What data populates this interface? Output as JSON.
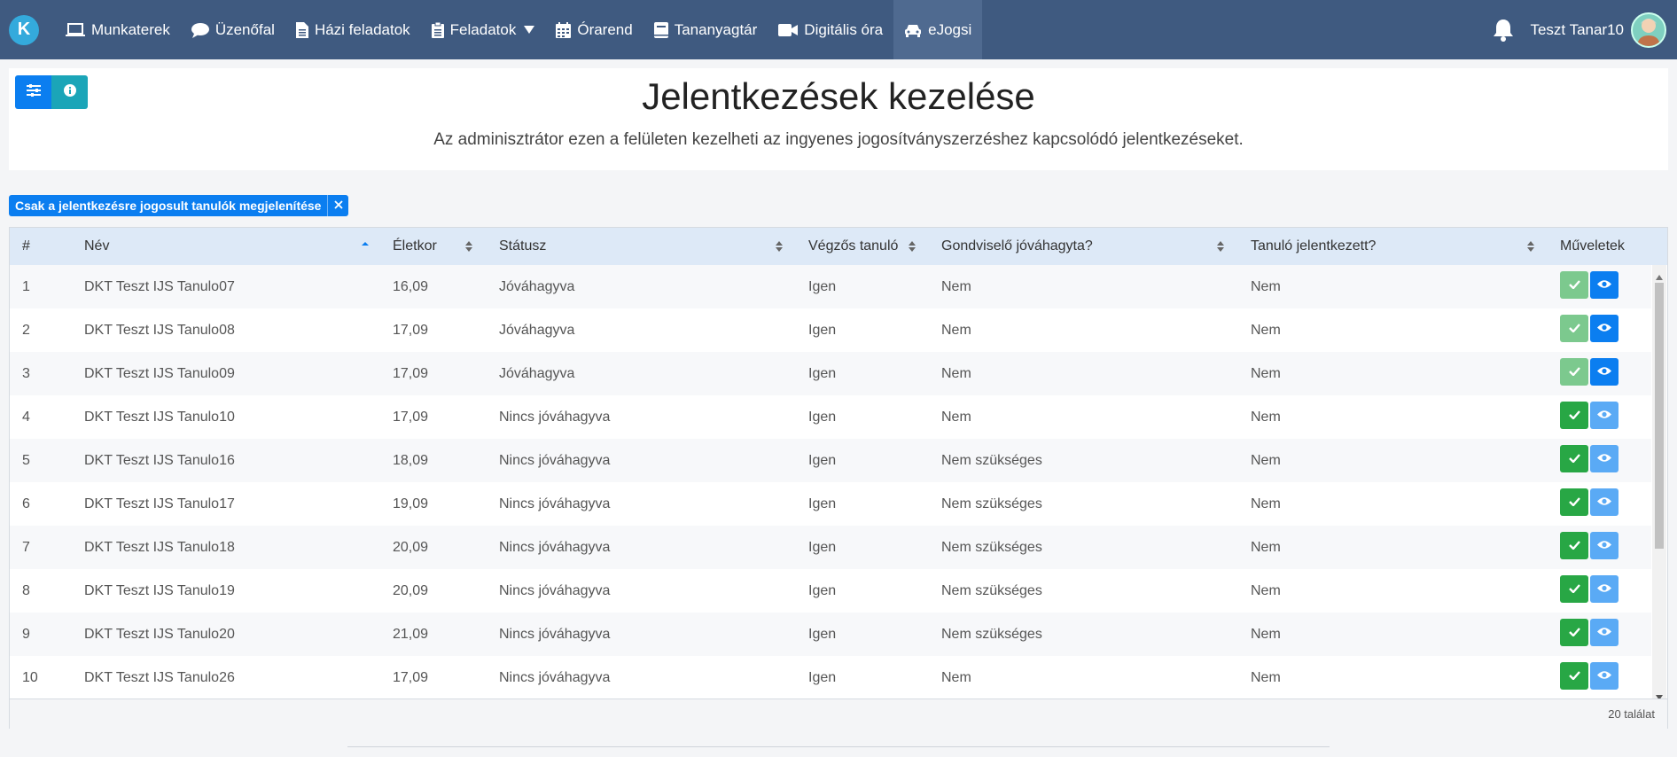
{
  "nav": {
    "logo": "K",
    "items": [
      {
        "label": "Munkaterek",
        "icon": "laptop-icon"
      },
      {
        "label": "Üzenőfal",
        "icon": "chat-icon"
      },
      {
        "label": "Házi feladatok",
        "icon": "document-icon"
      },
      {
        "label": "Feladatok",
        "icon": "clipboard-icon"
      },
      {
        "label": "Órarend",
        "icon": "calendar-icon"
      },
      {
        "label": "Tananyagtár",
        "icon": "book-icon"
      },
      {
        "label": "Digitális óra",
        "icon": "video-icon"
      },
      {
        "label": "eJogsi",
        "icon": "car-icon"
      }
    ],
    "user": "Teszt Tanar10"
  },
  "header": {
    "title": "Jelentkezések kezelése",
    "subtitle": "Az adminisztrátor ezen a felületen kezelheti az ingyenes jogosítványszerzéshez kapcsolódó jelentkezéseket."
  },
  "filter_chip": "Csak a jelentkezésre jogosult tanulók megjelenítése",
  "table": {
    "headers": [
      "#",
      "Név",
      "Életkor",
      "Státusz",
      "Végzős tanuló",
      "Gondviselő jóváhagyta?",
      "Tanuló jelentkezett?",
      "Műveletek"
    ],
    "rows": [
      {
        "n": "1",
        "name": "DKT Teszt IJS Tanulo07",
        "age": "16,09",
        "status": "Jóváhagyva",
        "final": "Igen",
        "guardian": "Nem",
        "applied": "Nem",
        "approved": true
      },
      {
        "n": "2",
        "name": "DKT Teszt IJS Tanulo08",
        "age": "17,09",
        "status": "Jóváhagyva",
        "final": "Igen",
        "guardian": "Nem",
        "applied": "Nem",
        "approved": true
      },
      {
        "n": "3",
        "name": "DKT Teszt IJS Tanulo09",
        "age": "17,09",
        "status": "Jóváhagyva",
        "final": "Igen",
        "guardian": "Nem",
        "applied": "Nem",
        "approved": true
      },
      {
        "n": "4",
        "name": "DKT Teszt IJS Tanulo10",
        "age": "17,09",
        "status": "Nincs jóváhagyva",
        "final": "Igen",
        "guardian": "Nem",
        "applied": "Nem",
        "approved": false
      },
      {
        "n": "5",
        "name": "DKT Teszt IJS Tanulo16",
        "age": "18,09",
        "status": "Nincs jóváhagyva",
        "final": "Igen",
        "guardian": "Nem szükséges",
        "applied": "Nem",
        "approved": false
      },
      {
        "n": "6",
        "name": "DKT Teszt IJS Tanulo17",
        "age": "19,09",
        "status": "Nincs jóváhagyva",
        "final": "Igen",
        "guardian": "Nem szükséges",
        "applied": "Nem",
        "approved": false
      },
      {
        "n": "7",
        "name": "DKT Teszt IJS Tanulo18",
        "age": "20,09",
        "status": "Nincs jóváhagyva",
        "final": "Igen",
        "guardian": "Nem szükséges",
        "applied": "Nem",
        "approved": false
      },
      {
        "n": "8",
        "name": "DKT Teszt IJS Tanulo19",
        "age": "20,09",
        "status": "Nincs jóváhagyva",
        "final": "Igen",
        "guardian": "Nem szükséges",
        "applied": "Nem",
        "approved": false
      },
      {
        "n": "9",
        "name": "DKT Teszt IJS Tanulo20",
        "age": "21,09",
        "status": "Nincs jóváhagyva",
        "final": "Igen",
        "guardian": "Nem szükséges",
        "applied": "Nem",
        "approved": false
      },
      {
        "n": "10",
        "name": "DKT Teszt IJS Tanulo26",
        "age": "17,09",
        "status": "Nincs jóváhagyva",
        "final": "Igen",
        "guardian": "Nem",
        "applied": "Nem",
        "approved": false
      }
    ],
    "count": "20 találat"
  },
  "colors": {
    "navbar": "#3f5a80",
    "primary": "#0b7ef0",
    "success": "#28a745",
    "success_faded": "#7cc98e",
    "primary_faded": "#5aaaf5",
    "header_bg": "#dde9f7"
  }
}
